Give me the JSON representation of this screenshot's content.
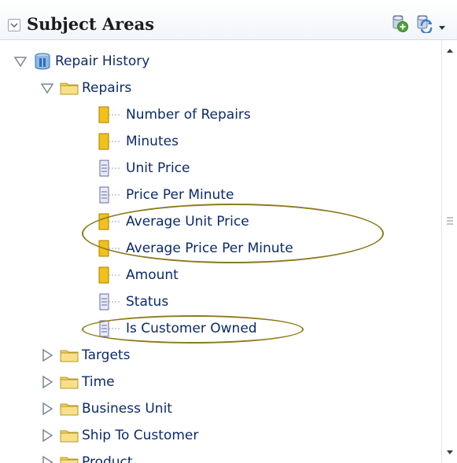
{
  "header": {
    "title": "Subject Areas",
    "icons": [
      "collapse-icon",
      "add-subject-area-icon",
      "refresh-icon",
      "dropdown-arrow-icon"
    ]
  },
  "tree": {
    "root": {
      "label": "Repair History",
      "expanded": true,
      "icon": "subject-area-icon"
    },
    "repairs_folder": {
      "label": "Repairs",
      "expanded": true,
      "icon": "folder-icon"
    },
    "columns": [
      {
        "label": "Number of Repairs",
        "type": "measure",
        "icon": "measure-column-icon"
      },
      {
        "label": "Minutes",
        "type": "measure",
        "icon": "measure-column-icon"
      },
      {
        "label": "Unit Price",
        "type": "attribute",
        "icon": "attribute-column-icon"
      },
      {
        "label": "Price Per Minute",
        "type": "attribute",
        "icon": "attribute-column-icon"
      },
      {
        "label": "Average Unit Price",
        "type": "measure",
        "icon": "measure-column-icon"
      },
      {
        "label": "Average Price Per Minute",
        "type": "measure",
        "icon": "measure-column-icon"
      },
      {
        "label": "Amount",
        "type": "measure",
        "icon": "measure-column-icon"
      },
      {
        "label": "Status",
        "type": "attribute",
        "icon": "attribute-column-icon"
      },
      {
        "label": "Is Customer Owned",
        "type": "attribute",
        "icon": "attribute-column-icon"
      }
    ],
    "folders": [
      {
        "label": "Targets",
        "expanded": false
      },
      {
        "label": "Time",
        "expanded": false
      },
      {
        "label": "Business Unit",
        "expanded": false
      },
      {
        "label": "Ship To Customer",
        "expanded": false
      },
      {
        "label": "Product",
        "expanded": false
      }
    ]
  },
  "colors": {
    "text": "#0b2a6b",
    "folder": "#f2d35c",
    "measure": "#f2c21a",
    "attribute": "#8a93c4",
    "highlight": "#8d7a1e"
  }
}
